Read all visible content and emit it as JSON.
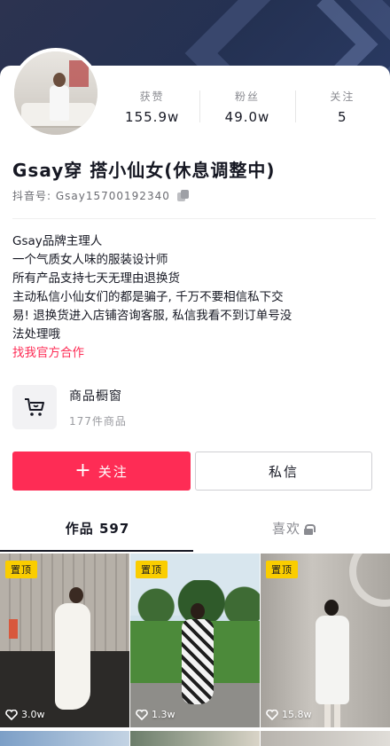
{
  "profile": {
    "stats": [
      {
        "label": "获赞",
        "value": "155.9w"
      },
      {
        "label": "粉丝",
        "value": "49.0w"
      },
      {
        "label": "关注",
        "value": "5"
      }
    ],
    "name": "Gsay穿 搭小仙女(休息调整中)",
    "douyin_id": "抖音号: Gsay15700192340"
  },
  "bio": {
    "lines": [
      "Gsay品牌主理人",
      "一个气质女人味的服装设计师",
      "所有产品支持七天无理由退换货",
      "主动私信小仙女们的都是骗子, 千万不要相信私下交",
      "易! 退换货进入店铺咨询客服, 私信我看不到订单号没",
      "法处理哦"
    ],
    "link": "找我官方合作"
  },
  "shop": {
    "title": "商品橱窗",
    "subtitle": "177件商品"
  },
  "actions": {
    "follow_plus": "+",
    "follow": "关注",
    "message": "私信"
  },
  "tabs": [
    {
      "label": "作品 597",
      "active": true
    },
    {
      "label": "喜欢",
      "active": false
    }
  ],
  "videos": [
    {
      "pinned": "置顶",
      "likes": "3.0w"
    },
    {
      "pinned": "置顶",
      "likes": "1.3w"
    },
    {
      "pinned": "置顶",
      "likes": "15.8w"
    }
  ],
  "colors": {
    "accent": "#fe2c55",
    "pin": "#facd00",
    "banner": "#2c3350"
  },
  "icons": {
    "copy": "copy-icon",
    "cart": "shopping-cart-icon",
    "lock": "lock-icon",
    "heart": "heart-icon"
  }
}
